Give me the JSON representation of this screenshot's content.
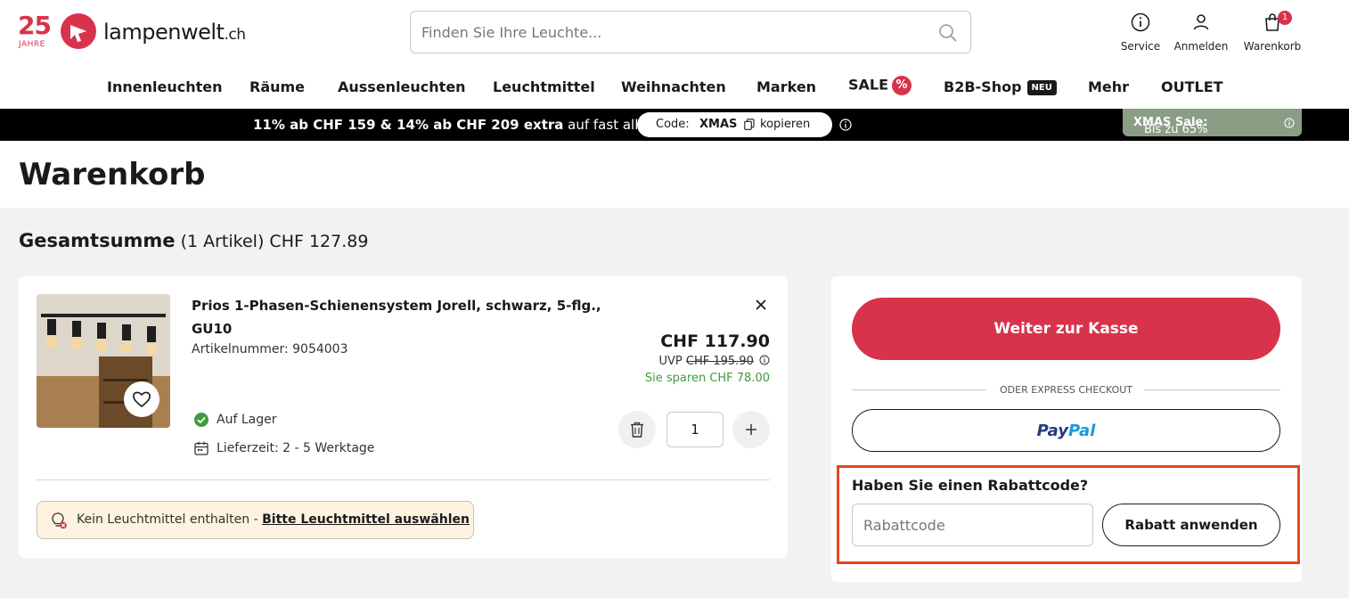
{
  "logo": {
    "number": "25",
    "jahre": "JAHRE",
    "name": "lampenwelt",
    "tld": ".ch"
  },
  "search": {
    "placeholder": "Finden Sie Ihre Leuchte..."
  },
  "top_icons": {
    "service": "Service",
    "login": "Anmelden",
    "cart": "Warenkorb",
    "cart_count": "1"
  },
  "nav": [
    {
      "label": "Innenleuchten"
    },
    {
      "label": "Räume"
    },
    {
      "label": "Aussenleuchten"
    },
    {
      "label": "Leuchtmittel"
    },
    {
      "label": "Weihnachten"
    },
    {
      "label": "Marken"
    },
    {
      "label": "SALE",
      "badge": "%"
    },
    {
      "label": "B2B-Shop",
      "badge": "NEU"
    },
    {
      "label": "Mehr"
    },
    {
      "label": "OUTLET"
    }
  ],
  "promo": {
    "bold_text": "11% ab CHF 159 & 14% ab CHF 209 extra",
    "text": " auf fast alles",
    "code_label": "Code:",
    "code": "XMAS",
    "copy_label": "kopieren",
    "tag_bold": "XMAS Sale:",
    "tag_text": " Bis zu 65%"
  },
  "page_title": "Warenkorb",
  "totals": {
    "label": "Gesamtsumme",
    "count": "(1 Artikel)",
    "amount": "CHF 127.89"
  },
  "item": {
    "name": "Prios 1-Phasen-Schienensystem Jorell, schwarz, 5-flg., GU10",
    "article_number": "Artikelnummer: 9054003",
    "price": "CHF 117.90",
    "uvp_label": "UVP",
    "uvp_value": "CHF 195.90",
    "savings": "Sie sparen CHF 78.00",
    "stock": "Auf Lager",
    "delivery": "Lieferzeit: 2 - 5 Werktage",
    "quantity": "1",
    "bulb_note": "Kein Leuchtmittel enthalten - ",
    "bulb_link": "Bitte Leuchtmittel auswählen"
  },
  "summary": {
    "checkout": "Weiter zur Kasse",
    "express_label": "ODER EXPRESS CHECKOUT",
    "paypal_a": "Pay",
    "paypal_b": "Pal",
    "coupon_title": "Haben Sie einen Rabattcode?",
    "coupon_placeholder": "Rabattcode",
    "coupon_button": "Rabatt anwenden"
  },
  "colors": {
    "brand": "#d8334a",
    "promo_bg": "#000000",
    "savings": "#3e9b3e",
    "highlight": "#e8451e",
    "xmas_tag": "#8a9e86"
  }
}
